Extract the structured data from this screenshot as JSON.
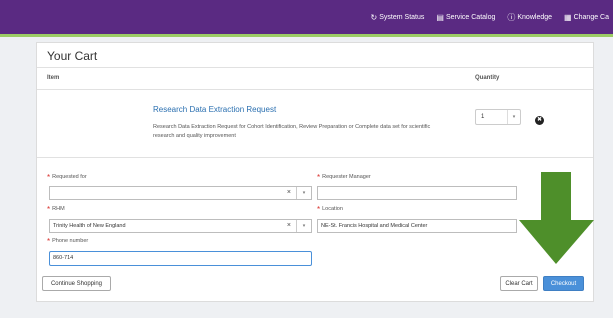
{
  "topnav": {
    "items": [
      {
        "label": "System Status",
        "icon": "refresh-icon"
      },
      {
        "label": "Service Catalog",
        "icon": "book-icon"
      },
      {
        "label": "Knowledge",
        "icon": "info-icon"
      },
      {
        "label": "Change Ca",
        "icon": "calendar-icon"
      }
    ]
  },
  "cart": {
    "title": "Your Cart",
    "columns": {
      "item": "Item",
      "quantity": "Quantity"
    },
    "item": {
      "name": "Research Data Extraction Request",
      "description": "Research Data Extraction Request for Cohort Identification, Review Preparation or Complete data set for scientific research and quality improvement",
      "quantity": "1"
    }
  },
  "form": {
    "requested_for": {
      "label": "Requested for",
      "value": ""
    },
    "requester_manager": {
      "label": "Requester Manager",
      "value": ""
    },
    "rhm": {
      "label": "RHM",
      "value": "Trinity Health of New England"
    },
    "location": {
      "label": "Location",
      "value": "NE-St. Francis Hospital and Medical Center"
    },
    "phone": {
      "label": "Phone number",
      "value": "860-714"
    }
  },
  "buttons": {
    "continue": "Continue Shopping",
    "clear": "Clear Cart",
    "checkout": "Checkout"
  },
  "colors": {
    "topbar": "#5a2a82",
    "accent_bar": "#9ccc65",
    "link": "#2a6fb0",
    "primary_button": "#4a90d9",
    "arrow": "#4e8f2a",
    "required": "#d9302c"
  }
}
